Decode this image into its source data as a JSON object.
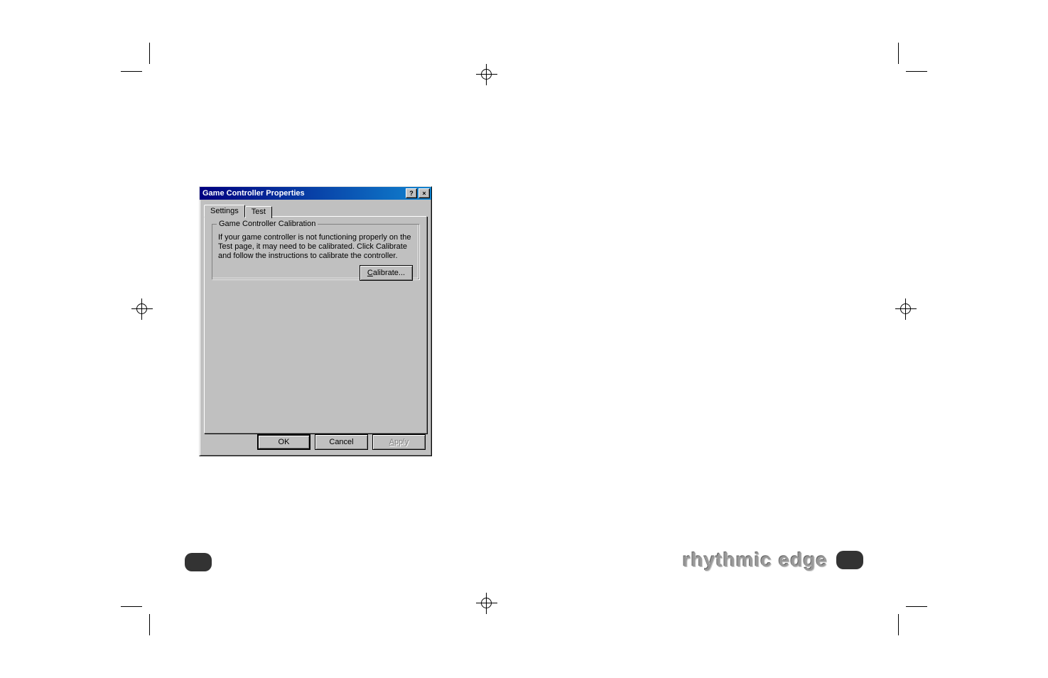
{
  "dialog": {
    "title": "Game Controller Properties",
    "help_btn": "?",
    "close_btn": "×",
    "tabs": [
      {
        "label": "Settings",
        "active": true
      },
      {
        "label": "Test",
        "active": false
      }
    ],
    "groupbox": {
      "title": "Game Controller Calibration",
      "text": "If your game controller is not functioning properly on the Test page, it may need to be calibrated.  Click Calibrate and follow the instructions to calibrate the controller.",
      "calibrate_label": "Calibrate..."
    },
    "footer": {
      "ok": "OK",
      "cancel": "Cancel",
      "apply": "Apply"
    }
  },
  "branding": {
    "text": "rhythmic edge"
  }
}
